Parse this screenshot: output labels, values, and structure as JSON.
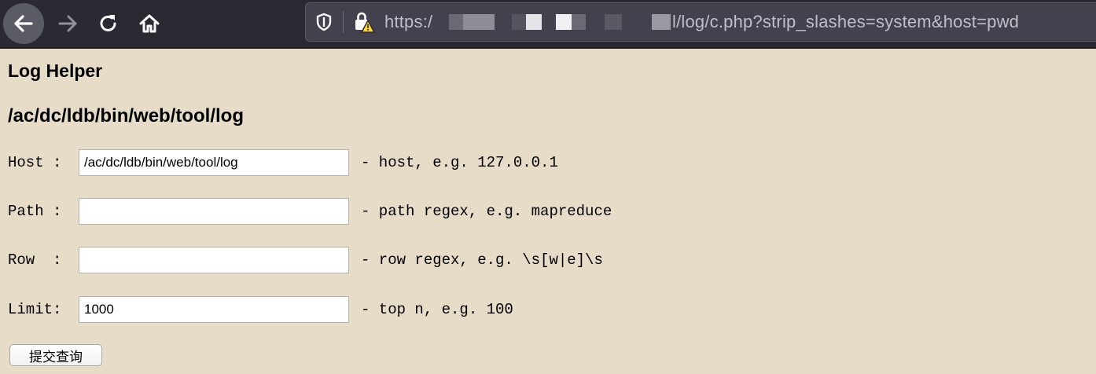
{
  "browser": {
    "url_prefix": "https:/",
    "url_suffix": "l/log/c.php?strip_slashes=system&host=pwd",
    "nav_icons": [
      "back-arrow-icon",
      "forward-arrow-icon",
      "reload-icon",
      "home-icon"
    ],
    "urlbar_icons": [
      "shield-icon",
      "insecure-lock-icon"
    ]
  },
  "page": {
    "title": "Log Helper",
    "cwd": "/ac/dc/ldb/bin/web/tool/log"
  },
  "form": {
    "host": {
      "label": "Host :",
      "value": "/ac/dc/ldb/bin/web/tool/log",
      "hint": "- host, e.g. 127.0.0.1"
    },
    "path": {
      "label": "Path :",
      "value": "",
      "hint": "- path regex, e.g. mapreduce"
    },
    "row": {
      "label": "Row  :",
      "value": "",
      "hint": "- row regex, e.g. \\s[w|e]\\s"
    },
    "limit": {
      "label": "Limit:",
      "value": "1000",
      "hint": "- top n, e.g. 100"
    },
    "submit_label": "提交查询"
  },
  "colors": {
    "page_background": "#e7dcc8",
    "toolbar_background": "#2b2a33",
    "urlbar_background": "#42414d",
    "warning_yellow": "#ffd43b"
  }
}
